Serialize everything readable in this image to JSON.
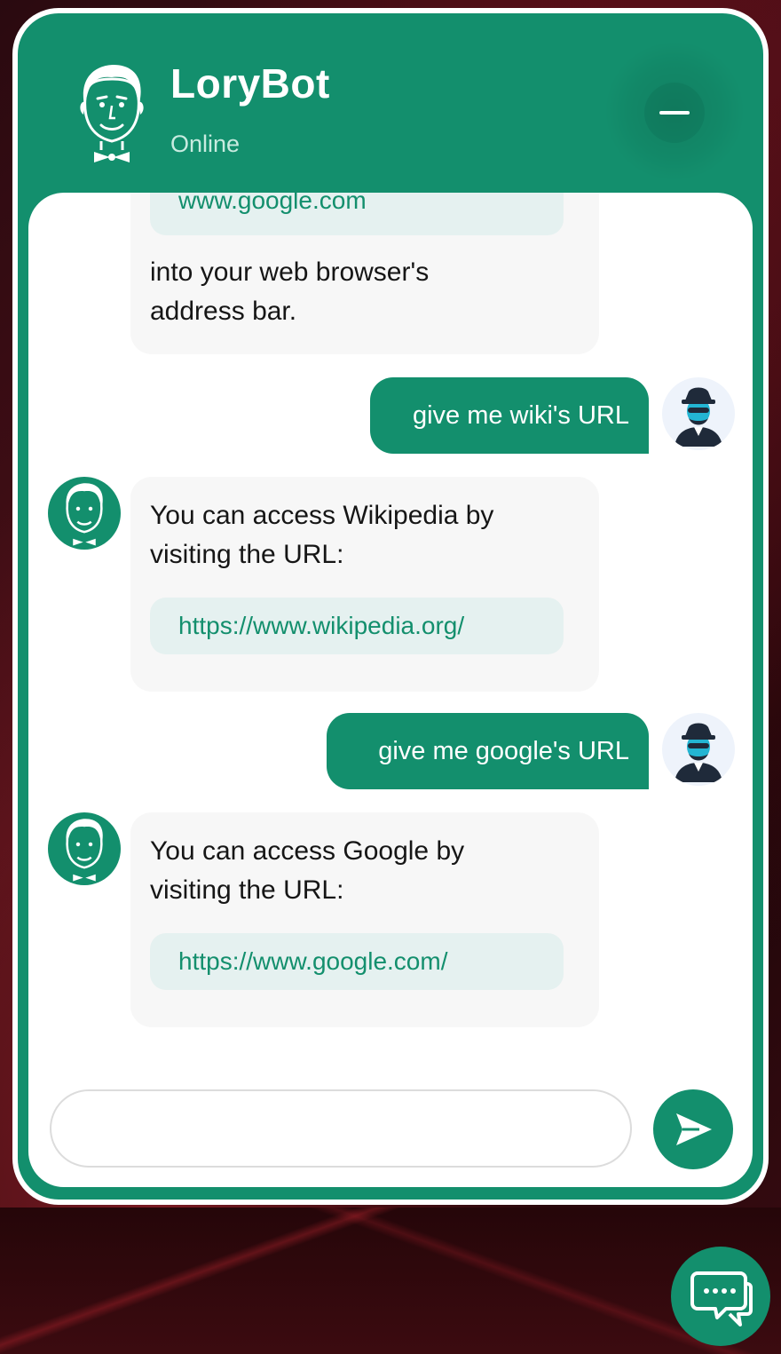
{
  "header": {
    "bot_name": "LoryBot",
    "status": "Online",
    "minimize_icon": "minus-icon"
  },
  "messages": [
    {
      "role": "bot",
      "link": "www.google.com",
      "text_after": "into your web browser's address bar."
    },
    {
      "role": "user",
      "text": "give me wiki's URL"
    },
    {
      "role": "bot",
      "text": "You can access Wikipedia by visiting the URL:",
      "link": "https://www.wikipedia.org/"
    },
    {
      "role": "user",
      "text": "give me google's URL"
    },
    {
      "role": "bot",
      "text": "You can access Google by visiting the URL:",
      "link": "https://www.google.com/"
    }
  ],
  "composer": {
    "placeholder": "",
    "send_icon": "send-icon"
  },
  "launcher": {
    "icon": "chat-bubble-icon"
  },
  "colors": {
    "brand": "#138f6d",
    "bubble_bot": "#f7f7f7",
    "link_pill": "#e5f1f0",
    "link_text": "#138f6d"
  }
}
